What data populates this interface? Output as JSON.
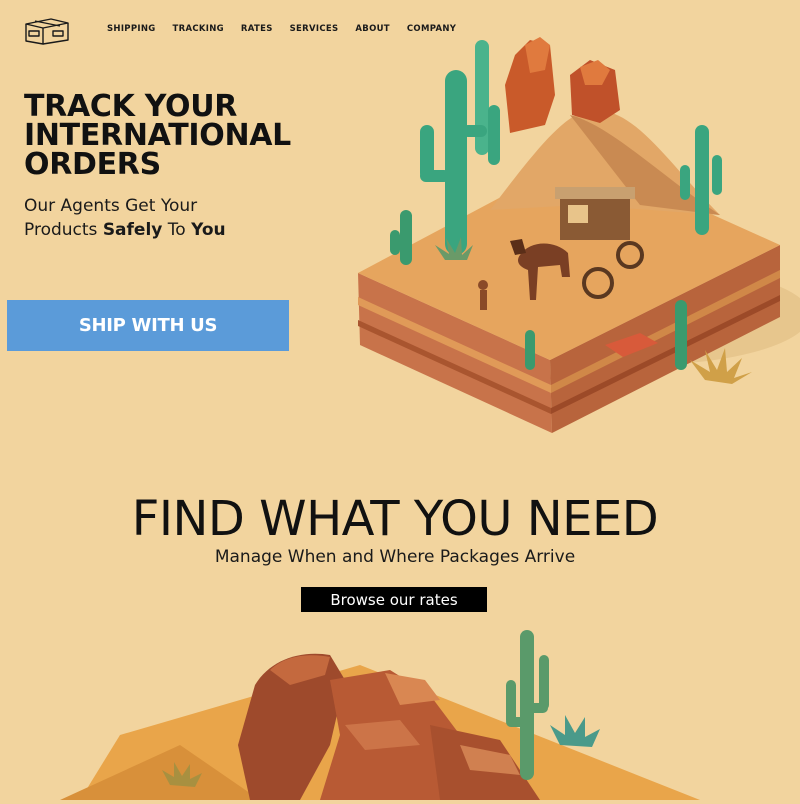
{
  "header": {
    "logo_icon": "package-box-icon",
    "nav": [
      "SHIPPING",
      "TRACKING",
      "RATES",
      "SERVICES",
      "ABOUT",
      "COMPANY"
    ]
  },
  "hero": {
    "title_lines": [
      "TRACK YOUR",
      "INTERNATIONAL",
      "ORDERS"
    ],
    "subtitle_line1": "Our Agents Get Your",
    "subtitle_line2_pre": "Products ",
    "subtitle_line2_bold1": "Safely",
    "subtitle_line2_mid": " To ",
    "subtitle_line2_bold2": "You",
    "cta_label": "SHIP WITH US",
    "illustration_icon": "desert-stagecoach-illustration"
  },
  "find": {
    "title": "FIND WHAT YOU NEED",
    "subtitle": "Manage When and Where Packages Arrive",
    "button_label": "Browse our rates",
    "illustration_icon": "desert-canyon-illustration"
  },
  "colors": {
    "background": "#f2d49e",
    "cta_blue": "#5b9bd9",
    "browse_black": "#000000"
  }
}
